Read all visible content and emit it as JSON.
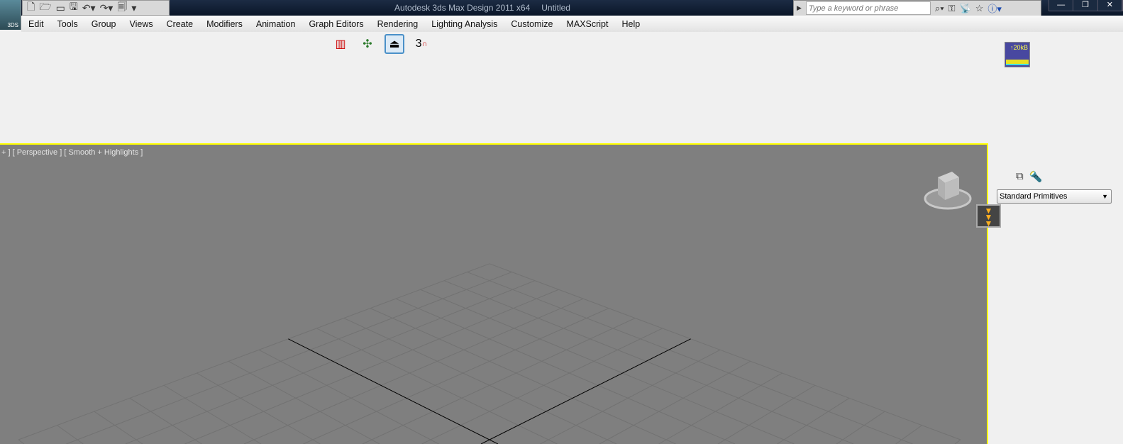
{
  "app_button": {
    "label": "3DS"
  },
  "window": {
    "app": "Autodesk 3ds Max Design 2011 x64",
    "document": "Untitled"
  },
  "quick_access": [
    "new",
    "open",
    "hold",
    "save",
    "undo",
    "redo",
    "project-folder"
  ],
  "search": {
    "placeholder": "Type a keyword or phrase"
  },
  "window_controls": {
    "minimize": "—",
    "restore": "❐",
    "close": "✕"
  },
  "menu": [
    "Edit",
    "Tools",
    "Group",
    "Views",
    "Create",
    "Modifiers",
    "Animation",
    "Graph Editors",
    "Rendering",
    "Lighting Analysis",
    "Customize",
    "MAXScript",
    "Help"
  ],
  "toolbar": {
    "snap_label": "3"
  },
  "memory": {
    "label": "↑20kB"
  },
  "viewport": {
    "label": "+ ] [ Perspective ] [ Smooth + Highlights ]",
    "border_color": "#ffff00"
  },
  "command_panel": {
    "dropdown": "Standard Primitives"
  }
}
